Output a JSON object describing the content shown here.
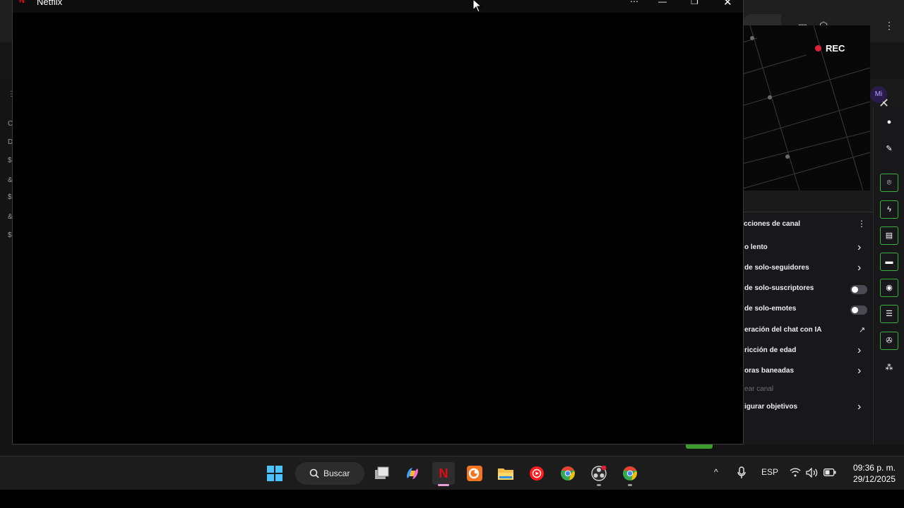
{
  "netflix_window": {
    "title": "Netflix",
    "logo": "N",
    "controls": {
      "more": "⋯",
      "minimize": "—",
      "maximize": "❐",
      "close": "✕"
    }
  },
  "background_app": {
    "edge_glyphs": [
      "⋮",
      "C",
      "D",
      "$",
      "&",
      "$",
      "&",
      "$"
    ],
    "avatar_text": "Mi",
    "close_label": "✕"
  },
  "stream_preview": {
    "rec_label": "REC"
  },
  "chat_panel": {
    "title": "cciones de canal",
    "more_icon": "⋮",
    "rows": [
      {
        "label": "o lento",
        "control": "chevron"
      },
      {
        "label": "de solo-seguidores",
        "control": "chevron"
      },
      {
        "label": "de solo-suscriptores",
        "control": "toggle",
        "on": false
      },
      {
        "label": "de solo-emotes",
        "control": "toggle",
        "on": false
      },
      {
        "label": "eración del chat con IA",
        "control": "external"
      },
      {
        "label": "ricción de edad",
        "control": "chevron"
      },
      {
        "label": "oras baneadas",
        "control": "chevron"
      },
      {
        "label": "ear canal",
        "control": "none",
        "dim": true
      },
      {
        "label": "igurar objetivos",
        "control": "chevron"
      }
    ],
    "chevron_glyph": "›",
    "external_glyph": "↗"
  },
  "right_toolbar": {
    "items": [
      "info-icon",
      "pencil-icon",
      "focus-icon",
      "bolt-icon",
      "list-icon",
      "chat-icon",
      "broadcast-icon",
      "layout-icon",
      "wrench-icon",
      "share-icon"
    ]
  },
  "taskbar": {
    "search_label": "Buscar",
    "apps": [
      "Start",
      "Task view",
      "Copilot",
      "Netflix",
      "Crunchyroll",
      "File Explorer",
      "YouTube Music",
      "Chrome",
      "OBS Studio",
      "Chrome"
    ],
    "tray": {
      "language": "ESP",
      "chevron": "^"
    },
    "clock": {
      "time": "09:36 p. m.",
      "date": "29/12/2025"
    }
  },
  "colors": {
    "netflix_red": "#e50914",
    "rec_red": "#e0203b",
    "tool_border_green": "#3fae3f",
    "taskbar_bg": "#1c1c1c"
  }
}
